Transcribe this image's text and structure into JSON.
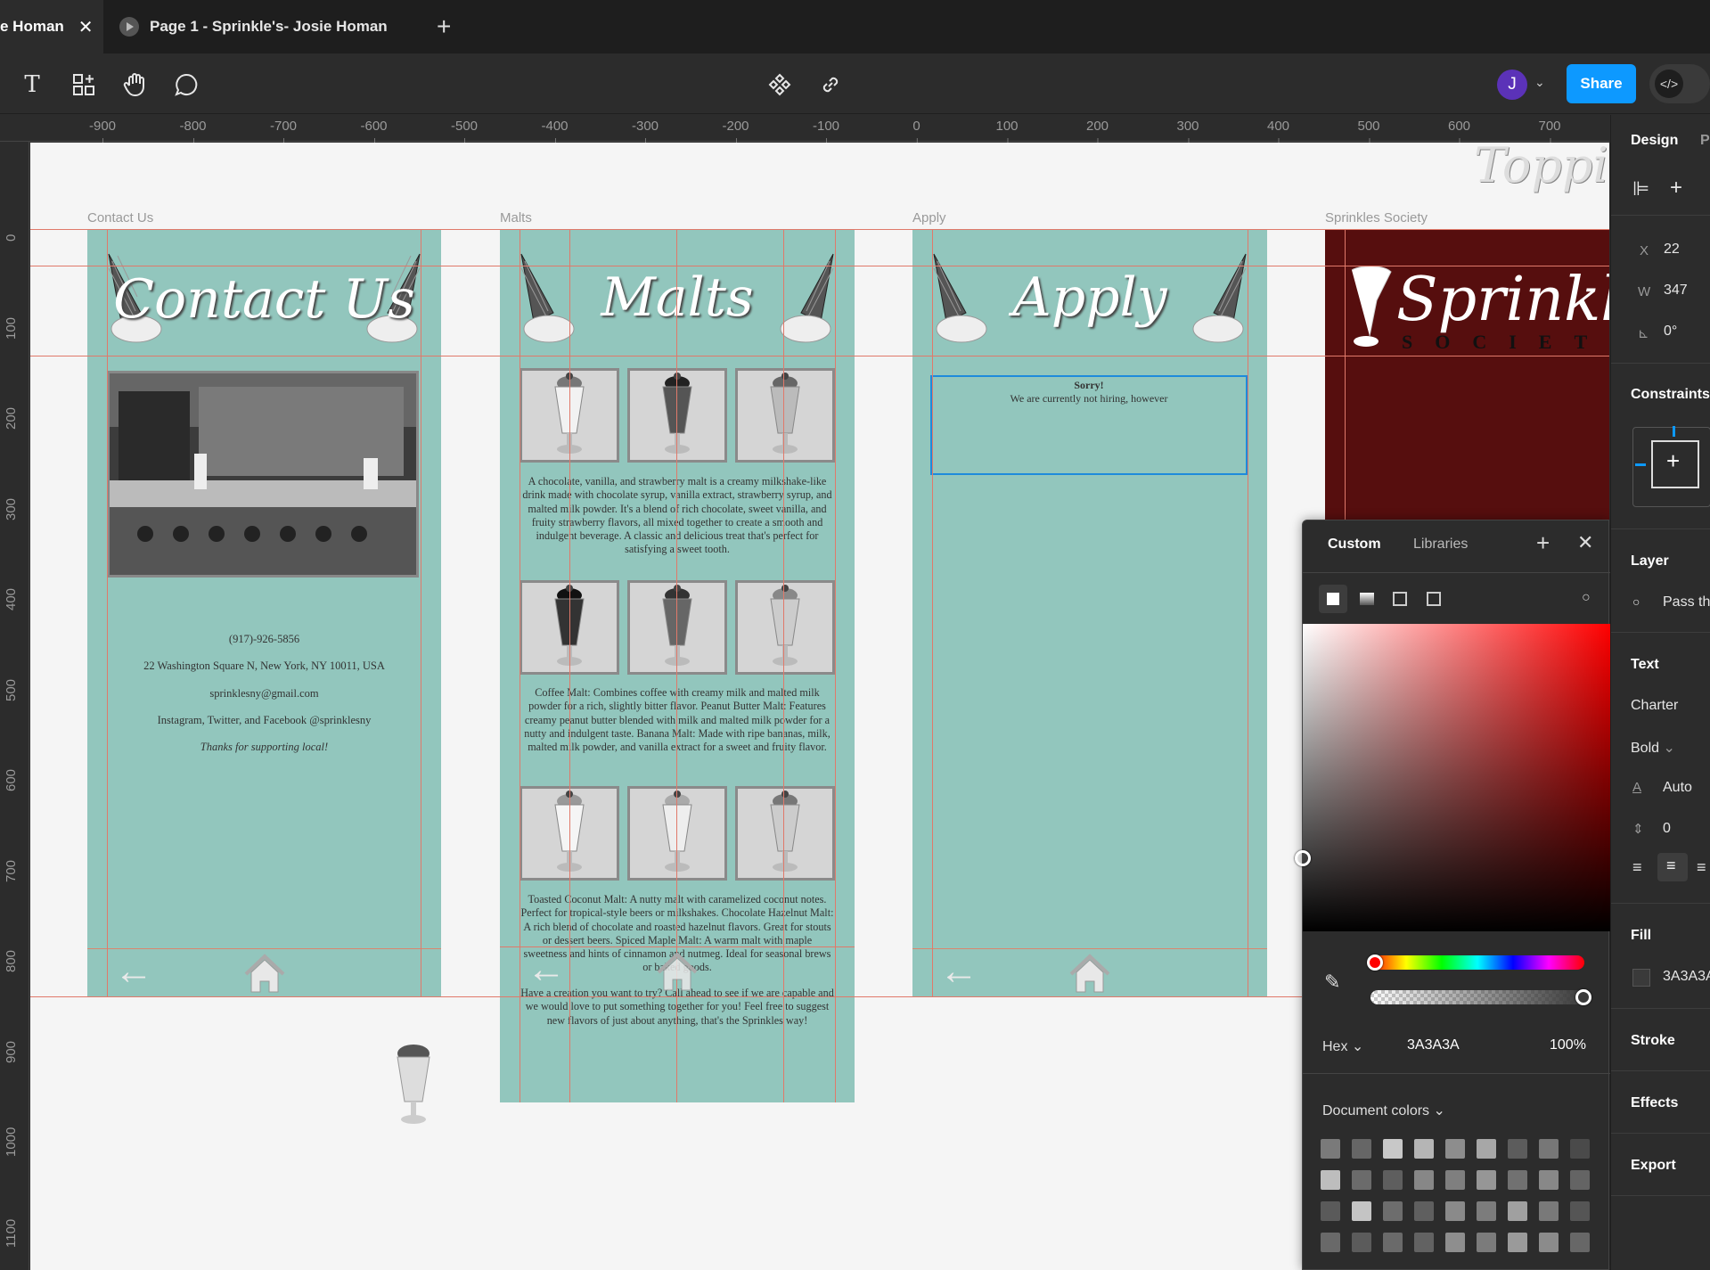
{
  "tabs": [
    {
      "label": "e Homan"
    },
    {
      "label": "Page 1 - Sprinkle's- Josie Homan"
    }
  ],
  "toolbar": {
    "avatar": "J",
    "share": "Share"
  },
  "ruler": {
    "x": [
      "-900",
      "-800",
      "-700",
      "-600",
      "-500",
      "-400",
      "-300",
      "-200",
      "-100",
      "0",
      "100",
      "200",
      "300",
      "400",
      "500",
      "600",
      "700"
    ],
    "y": [
      "0",
      "100",
      "200",
      "300",
      "400",
      "500",
      "600",
      "700",
      "800",
      "900",
      "1000",
      "1100"
    ]
  },
  "frames": {
    "contact": {
      "label": "Contact Us",
      "title": "Contact Us",
      "phone": "(917)-926-5856",
      "address": "22 Washington Square N, New York, NY 10011, USA",
      "email": "sprinklesny@gmail.com",
      "social": "Instagram, Twitter, and Facebook @sprinklesny",
      "thanks": "Thanks for supporting local!"
    },
    "malts": {
      "label": "Malts",
      "title": "Malts",
      "desc1": "A chocolate, vanilla, and strawberry malt is a creamy milkshake-like drink made with chocolate syrup, vanilla extract, strawberry syrup, and malted milk powder. It's a blend of rich chocolate, sweet vanilla, and fruity strawberry flavors, all mixed together to create a smooth and indulgent beverage. A classic and delicious treat that's perfect for satisfying a sweet tooth.",
      "desc2": "Coffee Malt: Combines coffee with creamy milk and malted milk powder for a rich, slightly bitter flavor. Peanut Butter Malt: Features creamy peanut butter blended with milk and malted milk powder for a nutty and indulgent taste. Banana Malt: Made with ripe bananas, milk, malted milk powder, and vanilla extract for a sweet and fruity flavor.",
      "desc3": "Toasted Coconut Malt: A nutty malt with caramelized coconut notes. Perfect for tropical-style beers or milkshakes. Chocolate Hazelnut Malt: A rich blend of chocolate and roasted hazelnut flavors. Great for stouts or dessert beers. Spiced Maple Malt: A warm malt with maple sweetness and hints of cinnamon and nutmeg. Ideal for seasonal brews or baked goods.",
      "desc4": "Have a creation you want to try? Call ahead to see if we are capable and we would love to put something together for you! Feel free to suggest new flavors of just about anything, that's the Sprinkles way!"
    },
    "apply": {
      "label": "Apply",
      "title": "Apply",
      "sorry": "Sorry!",
      "hiring": "We are currently not hiring, however"
    },
    "society": {
      "label": "Sprinkles Society",
      "title": "Sprinkles",
      "sub": "SOCIETY"
    },
    "toppings": "Toppings"
  },
  "colorpicker": {
    "tab_custom": "Custom",
    "tab_libraries": "Libraries",
    "format": "Hex",
    "hex": "3A3A3A",
    "opacity": "100%",
    "doc_colors": "Document colors",
    "swatches": [
      "#7a7a7a",
      "#666",
      "#c8c8c8",
      "#b5b5b5",
      "#8d8d8d",
      "#a7a7a7",
      "#5c5c5c",
      "#777",
      "#4a4a4a",
      "#bdbdbd",
      "#6b6b6b",
      "#5e5e5e",
      "#878787",
      "#7f7f7f",
      "#969696",
      "#717171",
      "#888",
      "#646464",
      "#5a5a5a",
      "#c4c4c4",
      "#6d6d6d",
      "#5f5f5f",
      "#8a8a8a",
      "#7c7c7c",
      "#a0a0a0",
      "#797979",
      "#555",
      "#696969",
      "#5b5b5b",
      "#6a6a6a",
      "#626262",
      "#8e8e8e",
      "#7b7b7b",
      "#9a9a9a",
      "#8b8b8b",
      "#676767"
    ]
  },
  "design": {
    "tab": "Design",
    "tab2": "Pr",
    "x_label": "X",
    "x": "22",
    "w_label": "W",
    "w": "347",
    "rot": "0°",
    "constraints": "Constraints",
    "layer": "Layer",
    "layer_mode": "Pass th",
    "text": "Text",
    "font": "Charter",
    "weight": "Bold",
    "line_height": "Auto",
    "letter_spacing": "0",
    "fill": "Fill",
    "fill_hex": "3A3A3A",
    "stroke": "Stroke",
    "effects": "Effects",
    "export": "Export"
  },
  "colors": {
    "accent": "#0d99ff",
    "frame": "#92c6bd",
    "society": "#560e0e",
    "guide": "#e0796a"
  }
}
